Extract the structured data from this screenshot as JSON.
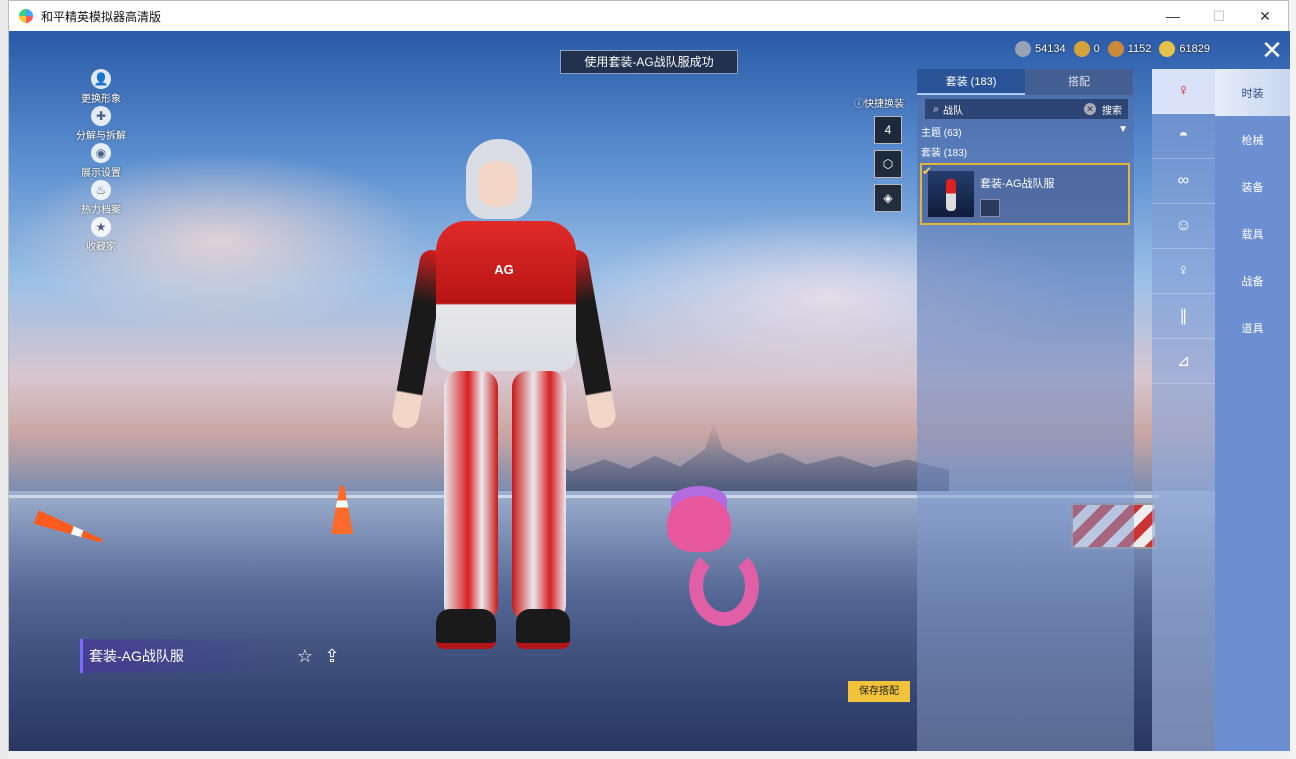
{
  "window": {
    "title": "和平精英模拟器高清版",
    "min": "—",
    "max": "☐",
    "close": "✕"
  },
  "toast": "使用套装-AG战队服成功",
  "side_menu": [
    {
      "label": "更换形象",
      "icon": "person-icon"
    },
    {
      "label": "分解与拆解",
      "icon": "puzzle-icon"
    },
    {
      "label": "展示设置",
      "icon": "eye-icon"
    },
    {
      "label": "热力档案",
      "icon": "fire-icon"
    },
    {
      "label": "收藏家",
      "icon": "collector-badge-icon"
    }
  ],
  "currency": [
    {
      "value": "54134",
      "color": "#9aa3b5",
      "icon": "coin-silver-icon"
    },
    {
      "value": "0",
      "color": "#d7a23a",
      "icon": "coupon-icon"
    },
    {
      "value": "1152",
      "color": "#c98a3a",
      "icon": "medal-icon"
    },
    {
      "value": "61829",
      "color": "#e6c24a",
      "icon": "gold-coin-icon"
    }
  ],
  "quick_switch": {
    "label": "快捷换装",
    "slots": [
      "4",
      "",
      ""
    ]
  },
  "panel": {
    "tabs": [
      {
        "label": "套装 (183)",
        "active": true
      },
      {
        "label": "搭配",
        "active": false
      }
    ],
    "search": {
      "value": "战队",
      "button": "搜索"
    },
    "theme_label": "主题 (63)",
    "theme_arrow": "▼",
    "set_label": "套装 (183)",
    "selected_item": {
      "name": "套装-AG战队服"
    }
  },
  "categories": [
    {
      "label": "时装",
      "active": true
    },
    {
      "label": "枪械",
      "active": false
    },
    {
      "label": "装备",
      "active": false
    },
    {
      "label": "载具",
      "active": false
    },
    {
      "label": "战备",
      "active": false
    },
    {
      "label": "道具",
      "active": false
    }
  ],
  "icon_column": [
    "outfit-icon",
    "cap-icon",
    "glasses-icon",
    "mask-icon",
    "top-icon",
    "pants-icon",
    "shoes-icon"
  ],
  "outfit_label": "套装-AG战队服",
  "save_button": "保存搭配",
  "char_logo": "AG"
}
